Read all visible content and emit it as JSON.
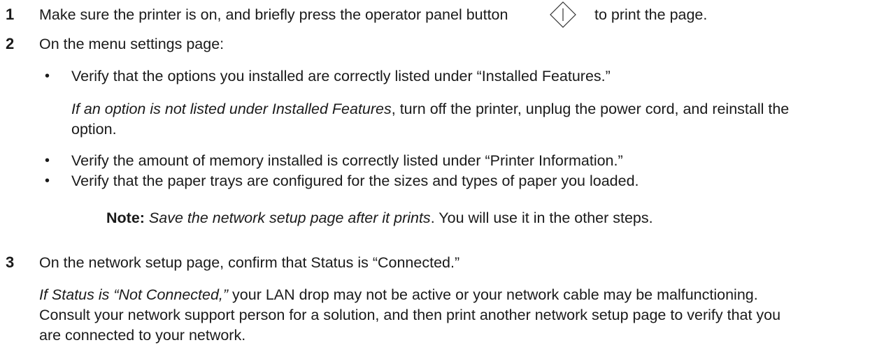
{
  "steps": [
    {
      "number": "1",
      "text_before_icon": "Make sure the printer is on, and briefly press the operator panel button",
      "icon": "operator-panel-go-button-icon",
      "text_after_icon": "to print the page."
    },
    {
      "number": "2",
      "text": "On the menu settings page:",
      "bullets": [
        {
          "marker": "•",
          "text": "Verify that the options you installed are correctly listed under “Installed Features.”",
          "note_italic": "If an option is not listed under Installed Features",
          "note_rest_line1": ", turn off the printer, unplug the power cord, and reinstall the",
          "note_line2": "option."
        },
        {
          "marker": "•",
          "text": "Verify the amount of memory installed is correctly listed under “Printer Information.”"
        },
        {
          "marker": "•",
          "text": "Verify that the paper trays are configured for the sizes and types of paper you loaded."
        }
      ],
      "note": {
        "label": "Note:",
        "italic": "Save the network setup page after it prints",
        "rest": ". You will use it in the other steps."
      }
    },
    {
      "number": "3",
      "text": "On the network setup page, confirm that Status is “Connected.”",
      "detail_italic": "If Status is “Not Connected,”",
      "detail_rest_line1": " your LAN drop may not be active or your network cable may be malfunctioning.",
      "detail_line2": "Consult your network support person for a solution, and then print another network setup page to verify that you",
      "detail_line3": "are connected to your network."
    }
  ]
}
